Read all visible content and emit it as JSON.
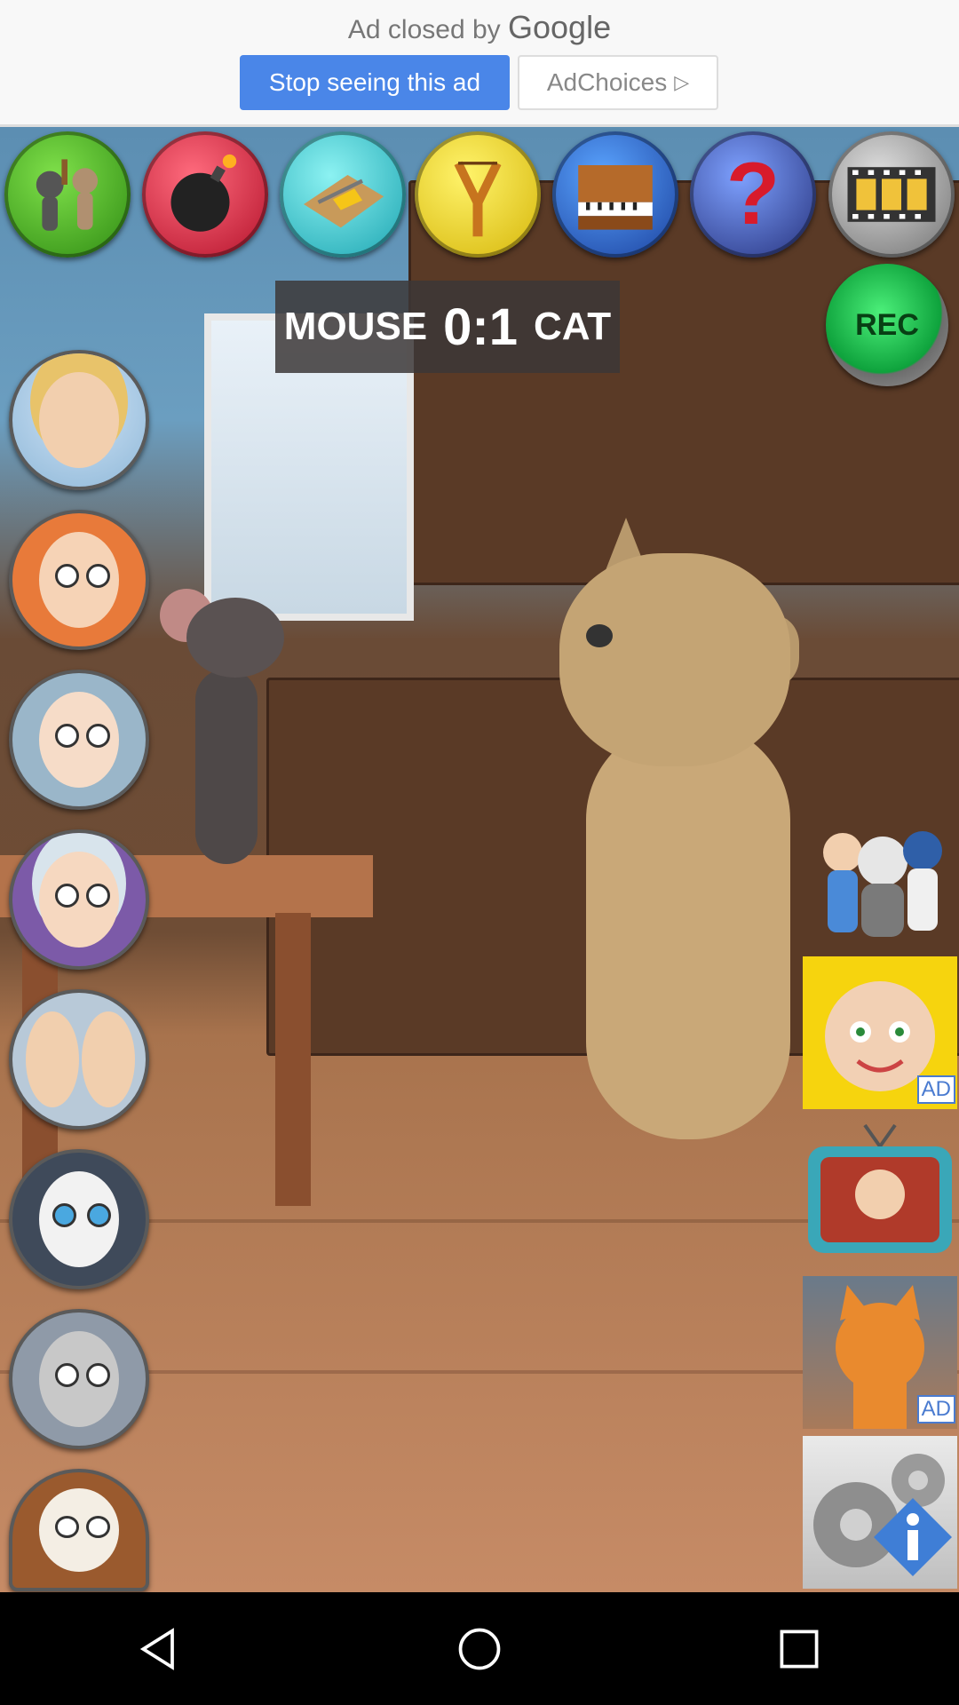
{
  "ad_banner": {
    "closed_prefix": "Ad closed by",
    "closed_brand": "Google",
    "stop_button": "Stop seeing this ad",
    "adchoices_button": "AdChoices"
  },
  "toolbar": [
    {
      "name": "fight",
      "icon": "fighters-icon"
    },
    {
      "name": "bomb",
      "icon": "bomb-icon"
    },
    {
      "name": "trap",
      "icon": "mousetrap-icon"
    },
    {
      "name": "slingshot",
      "icon": "slingshot-icon"
    },
    {
      "name": "piano",
      "icon": "piano-icon"
    },
    {
      "name": "help",
      "icon": "question-icon"
    },
    {
      "name": "film",
      "icon": "film-icon"
    }
  ],
  "rec_label": "REC",
  "score": {
    "left_name": "MOUSE",
    "left_score": "0",
    "separator": ":",
    "right_score": "1",
    "right_name": "CAT"
  },
  "characters": [
    {
      "name": "singer-fairy"
    },
    {
      "name": "redhead-girl"
    },
    {
      "name": "baby-boy"
    },
    {
      "name": "winter-baby"
    },
    {
      "name": "twin-babies"
    },
    {
      "name": "cat"
    },
    {
      "name": "hippo"
    },
    {
      "name": "squirrel"
    }
  ],
  "right_panel": {
    "group_icon": "friends-group-icon",
    "ad1_badge": "AD",
    "tv_icon": "tv-icon",
    "ad2_badge": "AD",
    "settings_icon": "settings-info-icon"
  },
  "colors": {
    "stop_button_bg": "#4a86e8",
    "rec_green": "#0ea23c"
  }
}
